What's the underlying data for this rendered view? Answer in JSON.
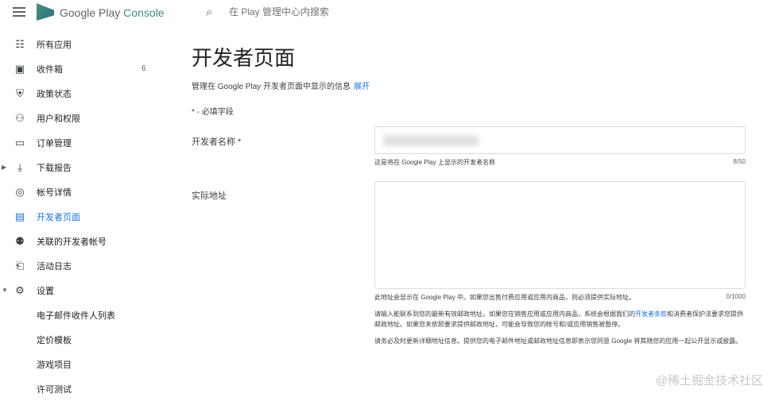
{
  "header": {
    "brand": "Google Play",
    "brand_suffix": "Console",
    "search_placeholder": "在 Play 管理中心内搜索"
  },
  "sidebar": {
    "items": [
      {
        "label": "所有应用",
        "icon": "grid-icon"
      },
      {
        "label": "收件箱",
        "icon": "inbox-icon",
        "count": "6"
      },
      {
        "label": "政策状态",
        "icon": "shield-icon"
      },
      {
        "label": "用户和权限",
        "icon": "users-icon"
      },
      {
        "label": "订单管理",
        "icon": "card-icon"
      },
      {
        "label": "下载报告",
        "icon": "download-icon"
      },
      {
        "label": "帐号详情",
        "icon": "account-icon"
      },
      {
        "label": "开发者页面",
        "icon": "web-icon",
        "active": true
      },
      {
        "label": "关联的开发者帐号",
        "icon": "linked-icon"
      },
      {
        "label": "活动日志",
        "icon": "log-icon"
      },
      {
        "label": "设置",
        "icon": "gear-icon"
      },
      {
        "label": "电子邮件收件人列表"
      },
      {
        "label": "定价模板"
      },
      {
        "label": "游戏项目"
      },
      {
        "label": "许可测试"
      }
    ]
  },
  "main": {
    "title": "开发者页面",
    "subtitle": "管理在 Google Play 开发者页面中显示的信息",
    "expand_link": "展开",
    "required_note": "* - 必填字段",
    "name_label": "开发者名称 *",
    "name_hint": "这是将在 Google Play 上显示的开发者名称",
    "name_count": "8/50",
    "address_label": "实际地址",
    "address_hint": "此地址会显示在 Google Play 中。如果您出售付费应用或应用内商品，则必须提供实际地址。",
    "address_count": "0/1000",
    "para1_a": "请输入能联系到您的最新有效邮政地址。如果您在销售应用或应用内商品，系统会根据我们的",
    "para1_link": "开发者条款",
    "para1_b": "和消费者保护法要求您提供邮政地址。如果您未依照要求提供邮政地址，可能会导致您的帐号和/或应用销售被暂停。",
    "para2": "请务必及时更新详细地址信息。提供您的电子邮件地址或邮政地址信息即表示您同意 Google 将其随您的应用一起公开显示或披露。"
  },
  "watermark": "@稀土掘金技术社区"
}
